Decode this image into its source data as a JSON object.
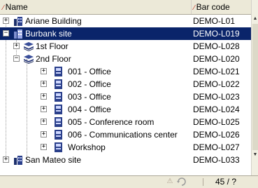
{
  "header": {
    "name_label": "Name",
    "barcode_label": "Bar code"
  },
  "rows": [
    {
      "name": "Ariane Building",
      "code": "DEMO-L01"
    },
    {
      "name": "Burbank site",
      "code": "DEMO-L019"
    },
    {
      "name": "1st Floor",
      "code": "DEMO-L028"
    },
    {
      "name": "2nd Floor",
      "code": "DEMO-L020"
    },
    {
      "name": "001 - Office",
      "code": "DEMO-L021"
    },
    {
      "name": "002 - Office",
      "code": "DEMO-L022"
    },
    {
      "name": "003 - Office",
      "code": "DEMO-L023"
    },
    {
      "name": "004 - Office",
      "code": "DEMO-L024"
    },
    {
      "name": "005 - Conference room",
      "code": "DEMO-L025"
    },
    {
      "name": "006 - Communications center",
      "code": "DEMO-L026"
    },
    {
      "name": "Workshop",
      "code": "DEMO-L027"
    },
    {
      "name": "San Mateo site",
      "code": "DEMO-L033"
    }
  ],
  "status": {
    "count": "45 / ?"
  },
  "colors": {
    "selection": "#0a246a",
    "chrome": "#ece9d8"
  }
}
